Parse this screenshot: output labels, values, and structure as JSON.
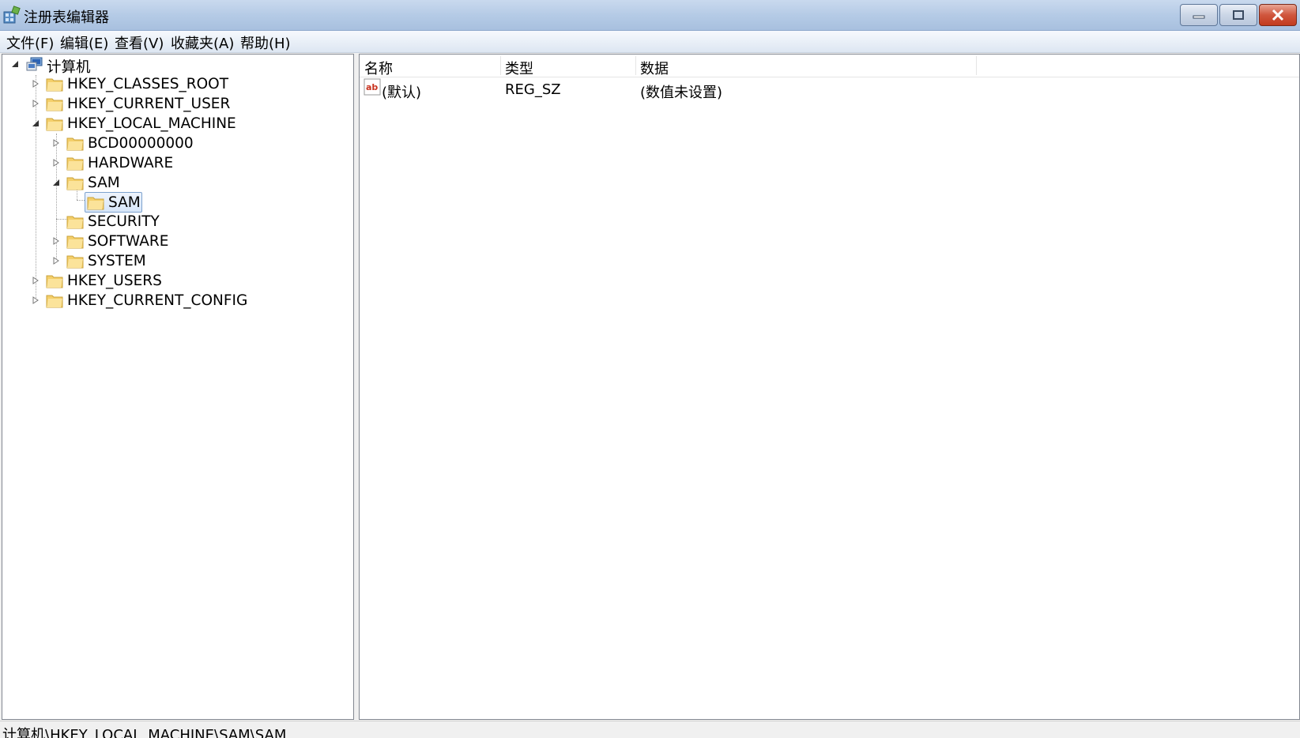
{
  "window": {
    "title": "注册表编辑器"
  },
  "menu": {
    "file": "文件(F)",
    "edit": "编辑(E)",
    "view": "查看(V)",
    "favorites": "收藏夹(A)",
    "help": "帮助(H)"
  },
  "tree": {
    "root": "计算机",
    "hkcr": "HKEY_CLASSES_ROOT",
    "hkcu": "HKEY_CURRENT_USER",
    "hklm": "HKEY_LOCAL_MACHINE",
    "bcd": "BCD00000000",
    "hardware": "HARDWARE",
    "sam": "SAM",
    "sam_child": "SAM",
    "security": "SECURITY",
    "software": "SOFTWARE",
    "system": "SYSTEM",
    "hku": "HKEY_USERS",
    "hkcc": "HKEY_CURRENT_CONFIG"
  },
  "list": {
    "headers": {
      "name": "名称",
      "type": "类型",
      "data": "数据"
    },
    "rows": [
      {
        "name": "(默认)",
        "type": "REG_SZ",
        "data": "(数值未设置)",
        "icon": "string-value-icon"
      }
    ]
  },
  "status": {
    "path": "计算机\\HKEY_LOCAL_MACHINE\\SAM\\SAM"
  },
  "colors": {
    "folder": "#f4cf6a",
    "selection_border": "#7da2ce",
    "close_red": "#c94a2e"
  }
}
